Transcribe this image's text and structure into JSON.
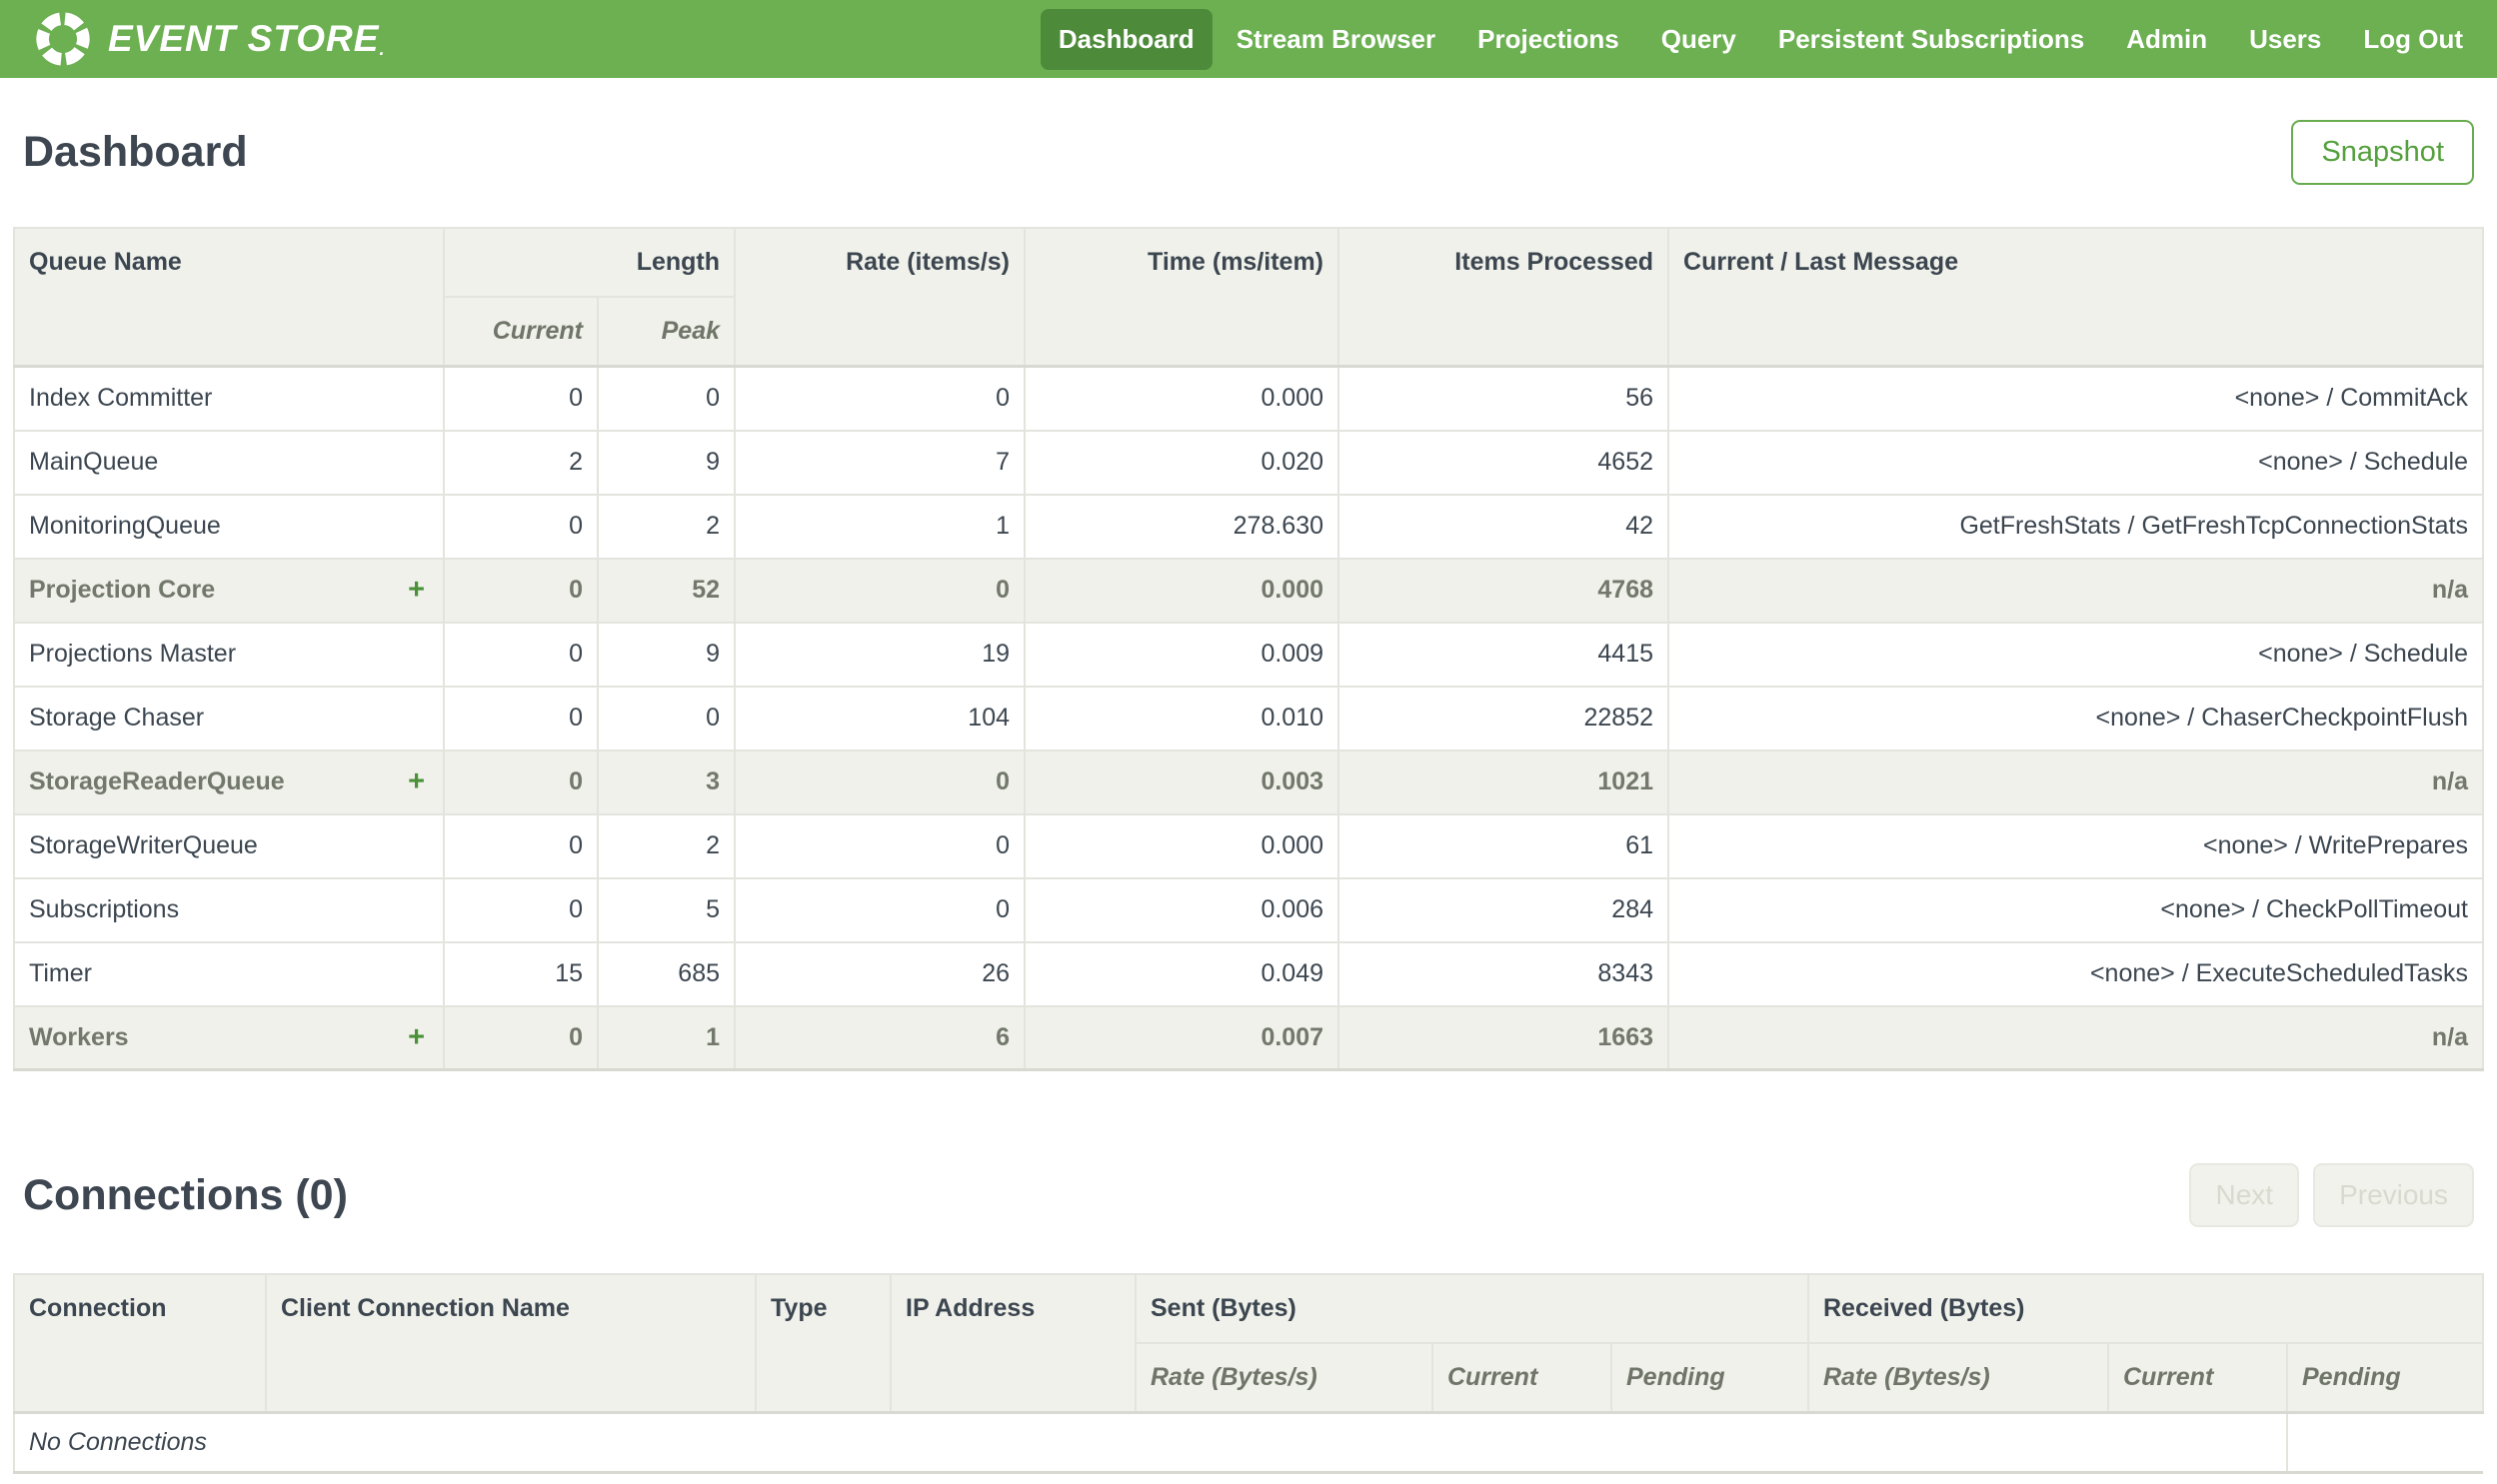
{
  "nav": {
    "brand": "EVENT STORE",
    "brand_mark": ".",
    "items": [
      {
        "label": "Dashboard",
        "active": true
      },
      {
        "label": "Stream Browser",
        "active": false
      },
      {
        "label": "Projections",
        "active": false
      },
      {
        "label": "Query",
        "active": false
      },
      {
        "label": "Persistent Subscriptions",
        "active": false
      },
      {
        "label": "Admin",
        "active": false
      },
      {
        "label": "Users",
        "active": false
      },
      {
        "label": "Log Out",
        "active": false
      }
    ]
  },
  "page": {
    "title": "Dashboard",
    "snapshot_button": "Snapshot"
  },
  "queues_table": {
    "expand_glyph": "+",
    "headers": {
      "queue_name": "Queue Name",
      "length": "Length",
      "current": "Current",
      "peak": "Peak",
      "rate": "Rate (items/s)",
      "time": "Time (ms/item)",
      "items": "Items Processed",
      "message": "Current / Last Message"
    },
    "rows": [
      {
        "name": "Index Committer",
        "expandable": false,
        "highlighted": false,
        "current": "0",
        "peak": "0",
        "rate": "0",
        "time": "0.000",
        "items": "56",
        "message": "<none> / CommitAck"
      },
      {
        "name": "MainQueue",
        "expandable": false,
        "highlighted": false,
        "current": "2",
        "peak": "9",
        "rate": "7",
        "time": "0.020",
        "items": "4652",
        "message": "<none> / Schedule"
      },
      {
        "name": "MonitoringQueue",
        "expandable": false,
        "highlighted": false,
        "current": "0",
        "peak": "2",
        "rate": "1",
        "time": "278.630",
        "items": "42",
        "message": "GetFreshStats / GetFreshTcpConnectionStats"
      },
      {
        "name": "Projection Core",
        "expandable": true,
        "highlighted": true,
        "current": "0",
        "peak": "52",
        "rate": "0",
        "time": "0.000",
        "items": "4768",
        "message": "n/a"
      },
      {
        "name": "Projections Master",
        "expandable": false,
        "highlighted": false,
        "current": "0",
        "peak": "9",
        "rate": "19",
        "time": "0.009",
        "items": "4415",
        "message": "<none> / Schedule"
      },
      {
        "name": "Storage Chaser",
        "expandable": false,
        "highlighted": false,
        "current": "0",
        "peak": "0",
        "rate": "104",
        "time": "0.010",
        "items": "22852",
        "message": "<none> / ChaserCheckpointFlush"
      },
      {
        "name": "StorageReaderQueue",
        "expandable": true,
        "highlighted": true,
        "current": "0",
        "peak": "3",
        "rate": "0",
        "time": "0.003",
        "items": "1021",
        "message": "n/a"
      },
      {
        "name": "StorageWriterQueue",
        "expandable": false,
        "highlighted": false,
        "current": "0",
        "peak": "2",
        "rate": "0",
        "time": "0.000",
        "items": "61",
        "message": "<none> / WritePrepares"
      },
      {
        "name": "Subscriptions",
        "expandable": false,
        "highlighted": false,
        "current": "0",
        "peak": "5",
        "rate": "0",
        "time": "0.006",
        "items": "284",
        "message": "<none> / CheckPollTimeout"
      },
      {
        "name": "Timer",
        "expandable": false,
        "highlighted": false,
        "current": "15",
        "peak": "685",
        "rate": "26",
        "time": "0.049",
        "items": "8343",
        "message": "<none> / ExecuteScheduledTasks"
      },
      {
        "name": "Workers",
        "expandable": true,
        "highlighted": true,
        "current": "0",
        "peak": "1",
        "rate": "6",
        "time": "0.007",
        "items": "1663",
        "message": "n/a"
      }
    ]
  },
  "connections": {
    "title": "Connections (0)",
    "pager": {
      "next": "Next",
      "previous": "Previous"
    },
    "headers": {
      "connection": "Connection",
      "client_name": "Client Connection Name",
      "type": "Type",
      "ip": "IP Address",
      "sent": "Sent (Bytes)",
      "received": "Received (Bytes)",
      "rate": "Rate (Bytes/s)",
      "current": "Current",
      "pending": "Pending"
    },
    "empty_message": "No Connections"
  },
  "colors": {
    "nav_green": "#6cb052",
    "nav_active_green": "#4d8b3a",
    "accent_green": "#4a9139",
    "header_bg": "#f0f1ea",
    "border": "#e3e4dd",
    "text_dark": "#3c4650",
    "text_muted": "#6f7569"
  }
}
